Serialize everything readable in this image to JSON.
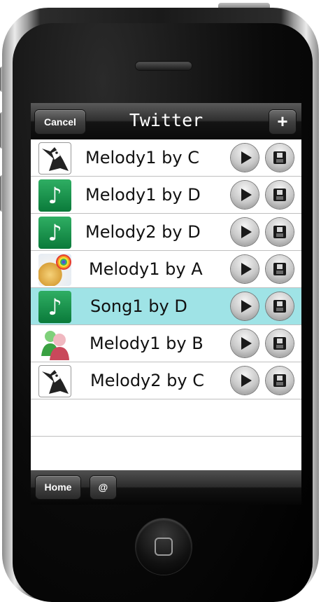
{
  "navbar": {
    "title": "Twitter",
    "cancel_label": "Cancel",
    "add_label": "+"
  },
  "songs": [
    {
      "title": "Melody1 by C",
      "icon": "bird-icon",
      "selected": false
    },
    {
      "title": "Melody1 by D",
      "icon": "music-note-icon",
      "selected": false
    },
    {
      "title": "Melody2 by D",
      "icon": "music-note-icon",
      "selected": false
    },
    {
      "title": "Melody1 by A",
      "icon": "rainbow-circle-icon",
      "selected": false
    },
    {
      "title": "Song1 by D",
      "icon": "music-note-icon",
      "selected": true
    },
    {
      "title": "Melody1 by B",
      "icon": "users-icon",
      "selected": false
    },
    {
      "title": "Melody2 by C",
      "icon": "bird-icon",
      "selected": false
    }
  ],
  "bottombar": {
    "home_label": "Home",
    "mentions_label": "@"
  },
  "colors": {
    "selected_row": "#9fe3e6",
    "note_icon_green": "#1e9a52"
  }
}
